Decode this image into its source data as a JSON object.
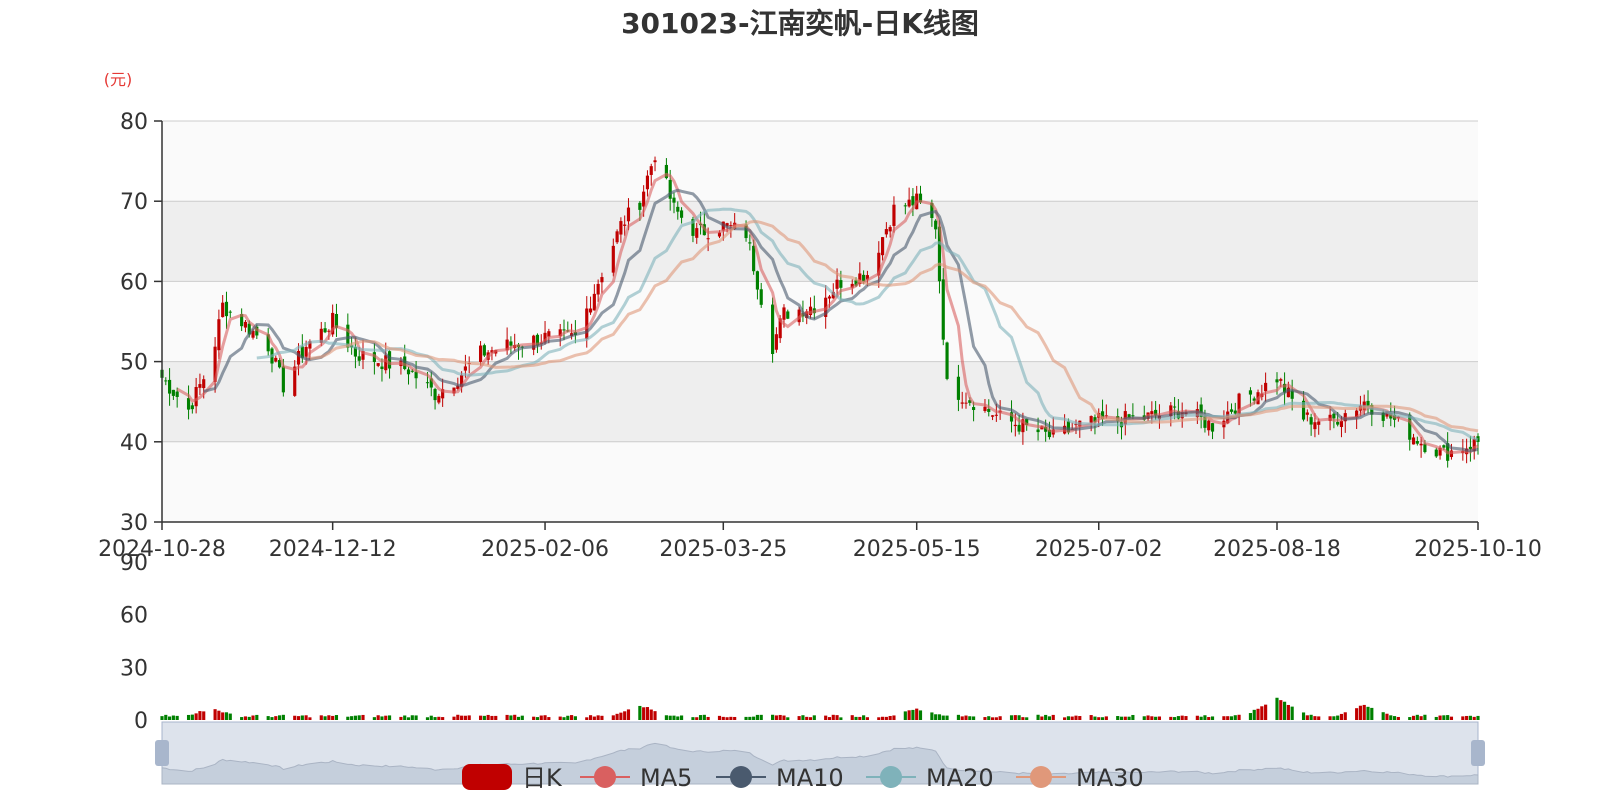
{
  "chart_data": {
    "type": "candlestick",
    "title": "301023-江南奕帆-日K线图",
    "ylabel": "(元)",
    "ylim": [
      30,
      80
    ],
    "yticks": [
      80,
      70,
      60,
      50,
      40,
      30
    ],
    "volume_yticks": [
      90,
      60,
      30,
      0
    ],
    "volume_ylim": [
      0,
      90
    ],
    "xticks": [
      "2024-10-28",
      "2024-12-12",
      "2025-02-06",
      "2025-03-25",
      "2025-05-15",
      "2025-07-02",
      "2025-08-18",
      "2025-10-10"
    ],
    "legend": [
      "日K",
      "MA5",
      "MA10",
      "MA20",
      "MA30"
    ],
    "grid": true,
    "colors": {
      "up": "#c00000",
      "down": "#008000",
      "ma5": "#d96060",
      "ma10": "#4a5a6e",
      "ma20": "#7fb2ba",
      "ma30": "#e0987a",
      "band": "#eeeeee",
      "grid": "#cccccc",
      "zoom_fill": "#dde3ec",
      "zoom_handle": "#a8b6cc"
    },
    "close_path_keypoints": [
      [
        "2024-10-28",
        48
      ],
      [
        "2024-11-04",
        44
      ],
      [
        "2024-11-10",
        50
      ],
      [
        "2024-11-13",
        57
      ],
      [
        "2024-11-18",
        55
      ],
      [
        "2024-11-25",
        52
      ],
      [
        "2024-11-29",
        47
      ],
      [
        "2024-12-05",
        52
      ],
      [
        "2024-12-12",
        55
      ],
      [
        "2024-12-18",
        51
      ],
      [
        "2024-12-25",
        50
      ],
      [
        "2025-01-01",
        49
      ],
      [
        "2025-01-08",
        46
      ],
      [
        "2025-01-14",
        48
      ],
      [
        "2025-01-20",
        51
      ],
      [
        "2025-01-27",
        52
      ],
      [
        "2025-02-06",
        53
      ],
      [
        "2025-02-14",
        53
      ],
      [
        "2025-02-20",
        60
      ],
      [
        "2025-02-26",
        67
      ],
      [
        "2025-03-03",
        70
      ],
      [
        "2025-03-07",
        76
      ],
      [
        "2025-03-12",
        69
      ],
      [
        "2025-03-18",
        66
      ],
      [
        "2025-03-25",
        67
      ],
      [
        "2025-03-31",
        66
      ],
      [
        "2025-04-07",
        52
      ],
      [
        "2025-04-10",
        56
      ],
      [
        "2025-04-18",
        57
      ],
      [
        "2025-04-25",
        60
      ],
      [
        "2025-05-02",
        61
      ],
      [
        "2025-05-09",
        69
      ],
      [
        "2025-05-15",
        70
      ],
      [
        "2025-05-20",
        67
      ],
      [
        "2025-05-23",
        47
      ],
      [
        "2025-06-06",
        43
      ],
      [
        "2025-06-20",
        40.5
      ],
      [
        "2025-06-27",
        42
      ],
      [
        "2025-07-02",
        42.5
      ],
      [
        "2025-07-14",
        43
      ],
      [
        "2025-07-24",
        44
      ],
      [
        "2025-08-01",
        42
      ],
      [
        "2025-08-08",
        45
      ],
      [
        "2025-08-15",
        47
      ],
      [
        "2025-08-18",
        48
      ],
      [
        "2025-08-25",
        43
      ],
      [
        "2025-09-01",
        42.5
      ],
      [
        "2025-09-10",
        45
      ],
      [
        "2025-09-17",
        43
      ],
      [
        "2025-09-25",
        40
      ],
      [
        "2025-10-01",
        38.5
      ],
      [
        "2025-10-10",
        40
      ]
    ],
    "volume_note_peaks": [
      [
        "2024-11-10",
        6
      ],
      [
        "2025-03-03",
        8
      ],
      [
        "2025-05-15",
        6
      ],
      [
        "2025-08-18",
        12
      ],
      [
        "2025-09-10",
        8
      ]
    ]
  }
}
